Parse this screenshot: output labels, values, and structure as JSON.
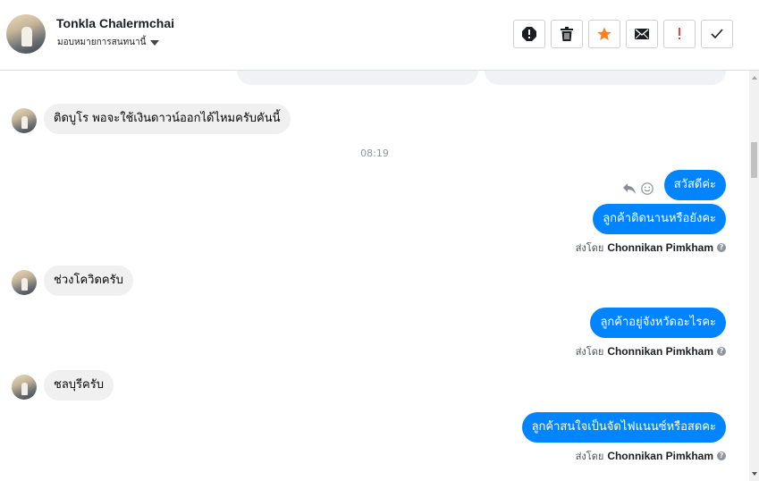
{
  "header": {
    "name": "Tonkla Chalermchai",
    "assign_label": "มอบหมายการสนทนานี้",
    "actions": [
      {
        "name": "report-spam-icon"
      },
      {
        "name": "trash-icon"
      },
      {
        "name": "star-icon"
      },
      {
        "name": "envelope-icon"
      },
      {
        "name": "exclamation-icon"
      },
      {
        "name": "checkmark-icon"
      }
    ]
  },
  "conversation": {
    "msg1": "ติดบูโร พอจะใช้เงินดาวน์ออกได้ไหมครับคันนี้",
    "time": "08:19",
    "msg2": "สวัสดีค่ะ",
    "msg3": "ลูกค้าติดนานหรือยังคะ",
    "sent_by_prefix": "ส่งโดย",
    "agent": "Chonnikan Pimkham",
    "msg4": "ช่วงโควิดครับ",
    "msg5": "ลูกค้าอยู่จังหวัดอะไรคะ",
    "msg6": "ชลบุรีครับ",
    "msg7": "ลูกค้าสนใจเป็นจัดไฟแนนซ์หรือสดคะ"
  },
  "colors": {
    "outgoing_bubble": "#0084ff",
    "incoming_bubble": "#f0f0f0",
    "star": "#f5821f",
    "exclamation": "#fa3e3e"
  }
}
